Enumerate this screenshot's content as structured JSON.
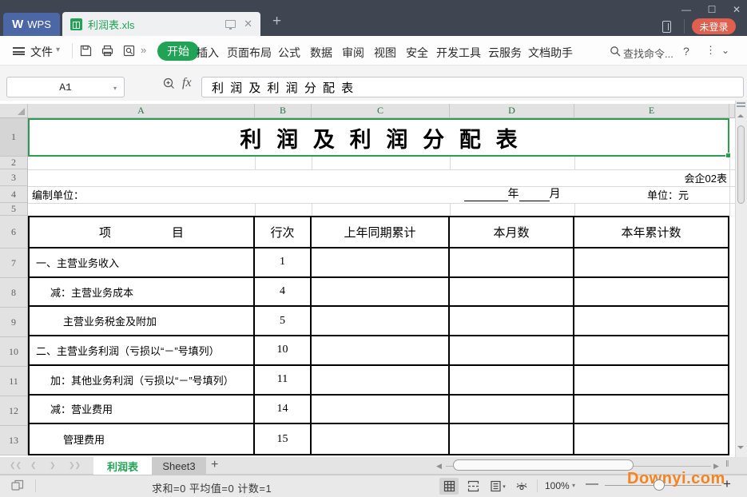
{
  "titlebar": {
    "wps_label": "WPS",
    "doc_tab_title": "利润表.xls",
    "new_tab_label": "+",
    "minimize_glyph": "—",
    "maximize_glyph": "☐",
    "close_glyph": "✕",
    "tab_close_glyph": "✕",
    "login_label": "未登录"
  },
  "menubar": {
    "menu_label": "文件",
    "more_label": "»",
    "tabs": [
      {
        "label": "开始"
      },
      {
        "label": "插入"
      },
      {
        "label": "页面布局"
      },
      {
        "label": "公式"
      },
      {
        "label": "数据"
      },
      {
        "label": "审阅"
      },
      {
        "label": "视图"
      },
      {
        "label": "安全"
      },
      {
        "label": "开发工具"
      },
      {
        "label": "云服务"
      },
      {
        "label": "文档助手"
      }
    ],
    "search_label": "查找命令...",
    "help_label": "?",
    "dots_label": "⋮",
    "collapse_label": "⌄"
  },
  "formula_bar": {
    "name_box": "A1",
    "fx_label": "fx",
    "formula": "利 润 及 利 润 分 配 表"
  },
  "grid": {
    "columns": [
      "A",
      "B",
      "C",
      "D",
      "E"
    ],
    "row_numbers": [
      "1",
      "2",
      "3",
      "4",
      "5",
      "6",
      "7",
      "8",
      "9",
      "10",
      "11",
      "12",
      "13"
    ],
    "title": "利 润 及 利 润 分 配 表",
    "form_code": "会企02表",
    "prepared_by": "编制单位：",
    "year_label": "年",
    "month_label": "月",
    "unit_label": "单位：元",
    "table": {
      "header": {
        "item_left": "项",
        "item_right": "目",
        "line_no": "行次",
        "prev_period": "上年同期累计",
        "current_month": "本月数",
        "year_total": "本年累计数"
      },
      "rows": [
        {
          "item": "一、主营业务收入",
          "line": "1"
        },
        {
          "item": "减：主营业务成本",
          "line": "4"
        },
        {
          "item": "主营业务税金及附加",
          "line": "5"
        },
        {
          "item": "二、主营业务利润（亏损以“－”号填列）",
          "line": "10"
        },
        {
          "item": "加：其他业务利润（亏损以“－”号填列）",
          "line": "11"
        },
        {
          "item": "减：营业费用",
          "line": "14"
        },
        {
          "item": "管理费用",
          "line": "15"
        }
      ]
    }
  },
  "sheetbar": {
    "tabs": [
      {
        "label": "利润表"
      },
      {
        "label": "Sheet3"
      }
    ],
    "add_label": "+"
  },
  "statusbar": {
    "summary": "求和=0  平均值=0  计数=1",
    "zoom_level": "100%",
    "minus_glyph": "—",
    "plus_glyph": "+"
  },
  "watermark": "Downyi.com",
  "colors": {
    "accent_green": "#21a356",
    "selection_green": "#2e9d53",
    "login_red": "#e0604f",
    "wps_blue": "#4c67a5",
    "titlebar_dark": "#3f4551",
    "watermark_orange": "#f5831e"
  }
}
